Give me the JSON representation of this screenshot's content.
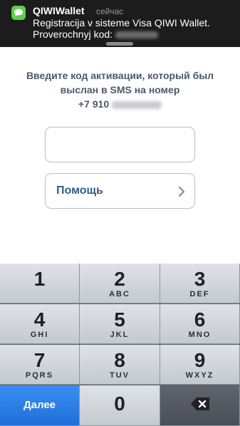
{
  "notification": {
    "app": "QIWIWallet",
    "time": "сейчас",
    "line1": "Registracija v sisteme Visa QIWI Wallet.",
    "line2_prefix": "Proverochnyj kod:"
  },
  "instructions": {
    "line1": "Введите код активации, который был",
    "line2": "выслан в SMS на номер",
    "phone_prefix": "+7 910"
  },
  "code_field": {
    "value": "",
    "placeholder": ""
  },
  "help_button": {
    "label": "Помощь"
  },
  "keyboard": {
    "keys": [
      {
        "digit": "1",
        "letters": ""
      },
      {
        "digit": "2",
        "letters": "ABC"
      },
      {
        "digit": "3",
        "letters": "DEF"
      },
      {
        "digit": "4",
        "letters": "GHI"
      },
      {
        "digit": "5",
        "letters": "JKL"
      },
      {
        "digit": "6",
        "letters": "MNO"
      },
      {
        "digit": "7",
        "letters": "PQRS"
      },
      {
        "digit": "8",
        "letters": "TUV"
      },
      {
        "digit": "9",
        "letters": "WXYZ"
      },
      {
        "digit": "0",
        "letters": ""
      }
    ],
    "next_label": "Далее",
    "delete_icon": "backspace-icon"
  },
  "colors": {
    "notification_bg": "#1c1c1c",
    "app_icon": "#5bd04a",
    "instruction_text": "#4b5a6a",
    "help_text": "#2e5e92",
    "next_key": "#2a7be6"
  }
}
